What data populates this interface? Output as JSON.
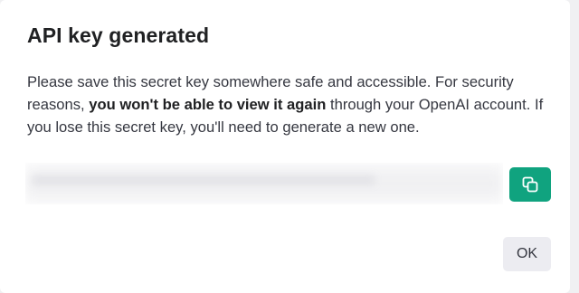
{
  "dialog": {
    "title": "API key generated",
    "message_part1": "Please save this secret key somewhere safe and accessible. For security reasons, ",
    "message_bold": "you won't be able to view it again",
    "message_part2": " through your OpenAI account. If you lose this secret key, you'll need to generate a new one.",
    "copy_icon": "copy-icon",
    "ok_label": "OK"
  },
  "colors": {
    "accent": "#10a37f",
    "title": "#202123",
    "text": "#353740",
    "secondary_button": "#ececf1"
  }
}
